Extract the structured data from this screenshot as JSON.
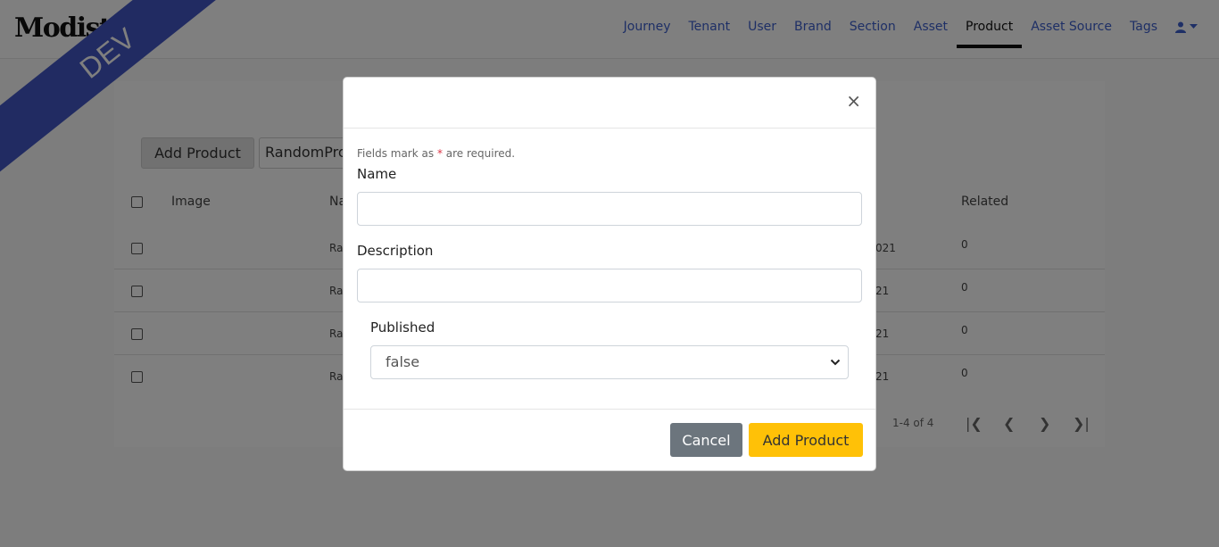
{
  "brand": {
    "logo_text": "Modist."
  },
  "env_ribbon": "DEV",
  "nav": {
    "items": [
      {
        "label": "Journey",
        "active": false
      },
      {
        "label": "Tenant",
        "active": false
      },
      {
        "label": "User",
        "active": false
      },
      {
        "label": "Brand",
        "active": false
      },
      {
        "label": "Section",
        "active": false
      },
      {
        "label": "Asset",
        "active": false
      },
      {
        "label": "Product",
        "active": true
      },
      {
        "label": "Asset Source",
        "active": false
      },
      {
        "label": "Tags",
        "active": false
      }
    ],
    "user_icon": "user-icon",
    "accent_color": "#3d5fcc"
  },
  "toolbar": {
    "add_product_label": "Add Product",
    "search_value": "RandomPro"
  },
  "table": {
    "headers": {
      "image": "Image",
      "name": "Na",
      "related": "Related"
    },
    "rows": [
      {
        "name_fragment": "Ra",
        "date_fragment": "021",
        "related": "0"
      },
      {
        "name_fragment": "Ra",
        "date_fragment": "21",
        "related": "0"
      },
      {
        "name_fragment": "Ra",
        "date_fragment": "21",
        "related": "0"
      },
      {
        "name_fragment": "Ra",
        "date_fragment": "21",
        "related": "0"
      }
    ],
    "pager_text": "1-4 of 4"
  },
  "modal": {
    "hint_prefix": "Fields mark as",
    "hint_star": "*",
    "hint_suffix": "are required.",
    "name_label": "Name",
    "name_value": "",
    "description_label": "Description",
    "description_value": "",
    "published_label": "Published",
    "published_value": "false",
    "cancel_label": "Cancel",
    "submit_label": "Add Product",
    "close_glyph": "×"
  },
  "colors": {
    "ribbon": "#4357c4",
    "submit": "#ffc107",
    "cancel": "#6c757d",
    "required": "#dc3545"
  }
}
